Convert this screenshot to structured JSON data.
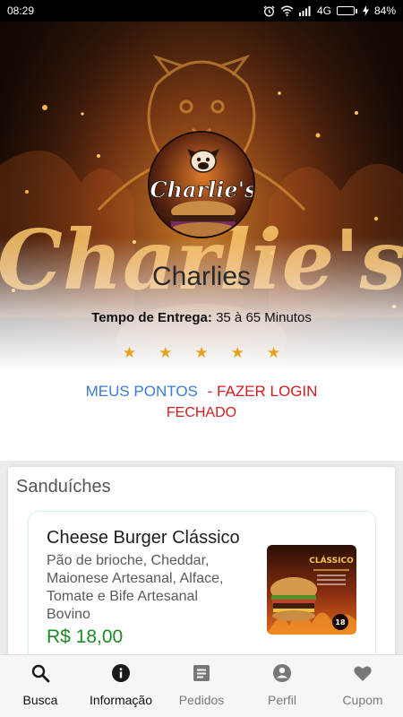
{
  "status_bar": {
    "time": "08:29",
    "network": "4G",
    "battery": "84%",
    "battery_level": 0.84,
    "icons": [
      "alarm-icon",
      "wifi-icon",
      "signal-icon",
      "battery-icon"
    ]
  },
  "store": {
    "logo_text": "Charlie's",
    "name": "Charlies",
    "delivery_label": "Tempo de Entrega:",
    "delivery_value": "35 à 65 Minutos",
    "rating": 5,
    "star_color": "#e6a21f",
    "points_link": "MEUS PONTOS",
    "login_link": "- FAZER LOGIN",
    "status": "FECHADO"
  },
  "menu": {
    "section_title": "Sanduíches",
    "products": [
      {
        "name": "Cheese Burger Clássico",
        "description": "Pão de brioche, Cheddar, Maionese Artesanal, Alface, Tomate e Bife Artesanal Bovino",
        "price": "R$ 18,00",
        "image_title": "CLÁSSICO",
        "image_badge": "18"
      }
    ]
  },
  "bottom_nav": [
    {
      "label": "Busca",
      "icon": "search-icon",
      "active": true
    },
    {
      "label": "Informação",
      "icon": "info-icon",
      "active": true
    },
    {
      "label": "Pedidos",
      "icon": "orders-icon",
      "active": false
    },
    {
      "label": "Perfil",
      "icon": "profile-icon",
      "active": false
    },
    {
      "label": "Cupom",
      "icon": "heart-icon",
      "active": false
    }
  ],
  "colors": {
    "link_blue": "#3d7ad1",
    "accent_red": "#d21c23",
    "price_green": "#1e8a27",
    "battery_green": "#7ed321"
  }
}
